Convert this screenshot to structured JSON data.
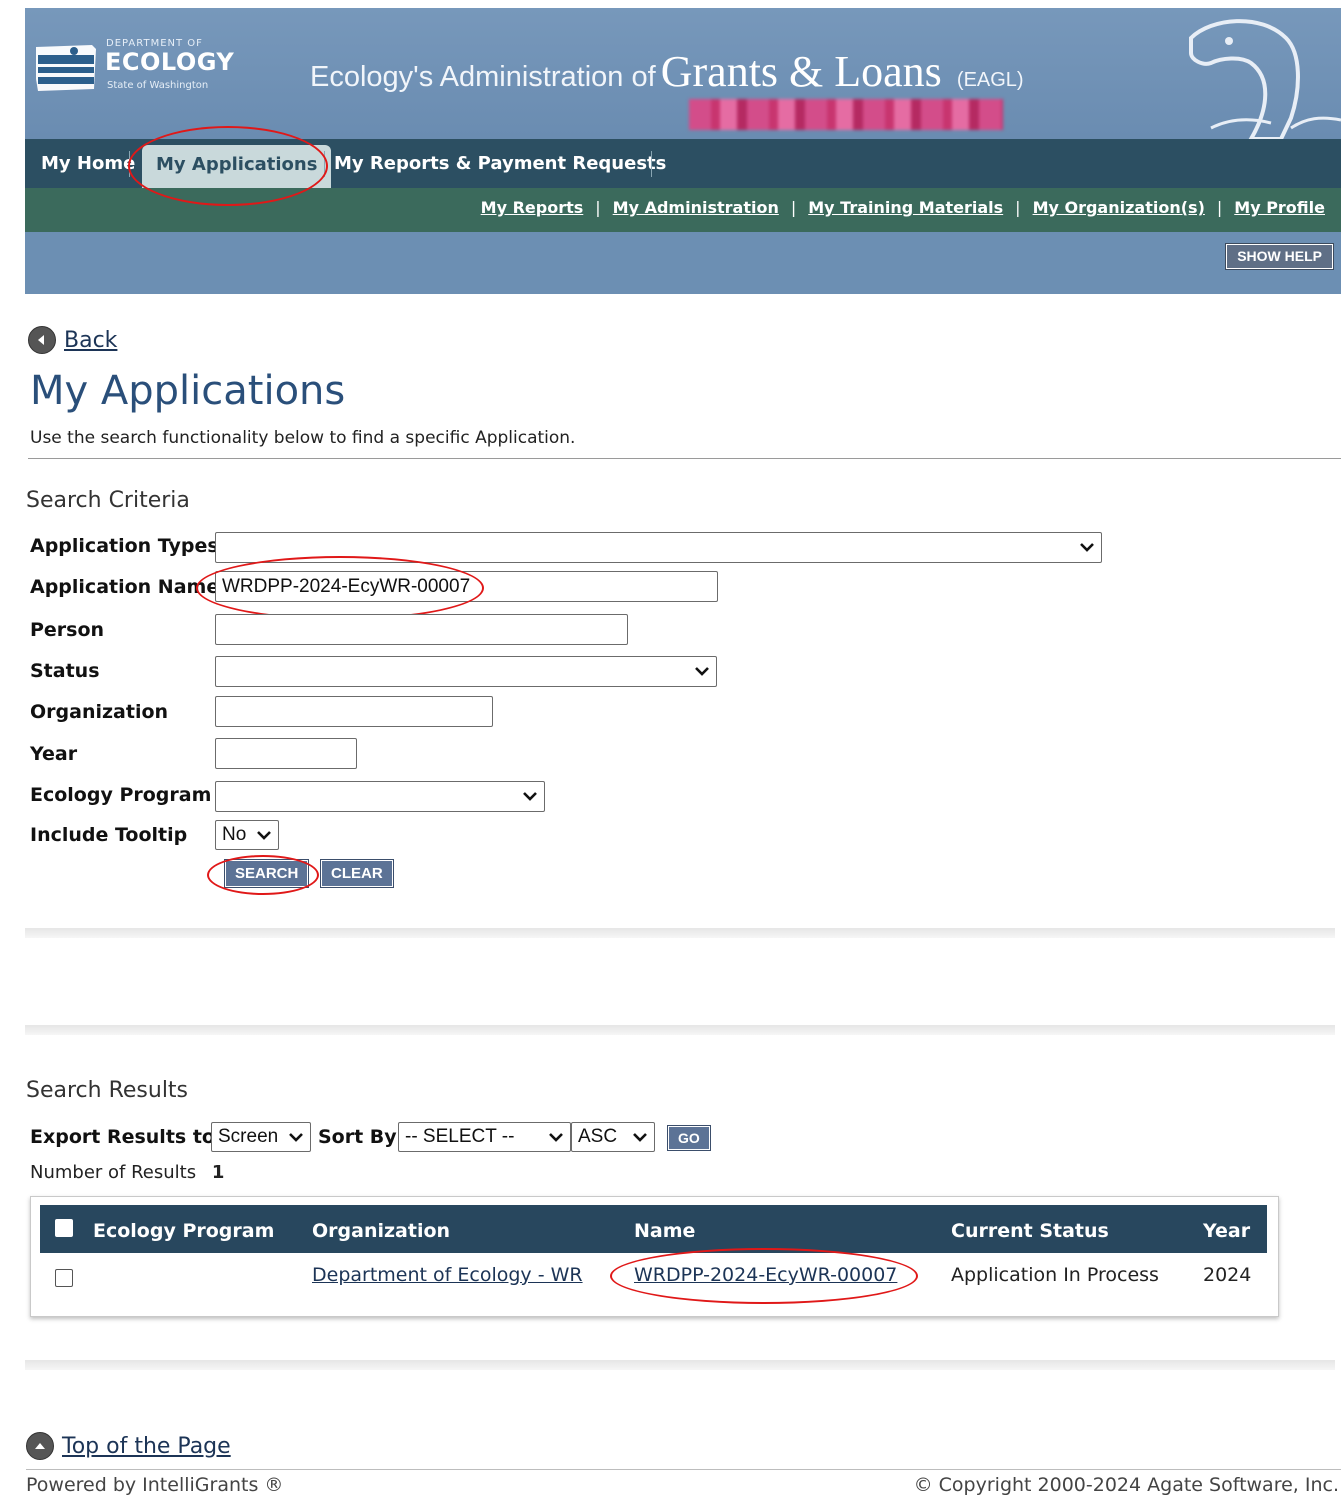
{
  "header": {
    "logo": {
      "dept": "DEPARTMENT OF",
      "name": "ECOLOGY",
      "state": "State of Washington"
    },
    "title_prefix": "Ecology's Administration of",
    "title_main": "Grants & Loans",
    "title_abbr": "(EAGL)"
  },
  "nav": {
    "tabs": [
      {
        "label": "My Home"
      },
      {
        "label": "My Applications"
      },
      {
        "label": "My Reports & Payment Requests"
      }
    ],
    "sublinks": [
      {
        "label": "My Reports"
      },
      {
        "label": "My Administration"
      },
      {
        "label": "My Training Materials"
      },
      {
        "label": "My Organization(s)"
      },
      {
        "label": "My Profile"
      }
    ],
    "help_button": "SHOW HELP"
  },
  "page": {
    "back": "Back",
    "title": "My Applications",
    "subtitle": "Use the search functionality below to find a specific Application."
  },
  "search": {
    "heading": "Search Criteria",
    "labels": {
      "application_types": "Application Types",
      "application_name": "Application Name",
      "person": "Person",
      "status": "Status",
      "organization": "Organization",
      "year": "Year",
      "ecology_program": "Ecology Program",
      "include_tooltip": "Include Tooltip"
    },
    "values": {
      "application_types": "",
      "application_name": "WRDPP-2024-EcyWR-00007",
      "person": "",
      "status": "",
      "organization": "",
      "year": "",
      "ecology_program": "",
      "include_tooltip": "No"
    },
    "search_button": "SEARCH",
    "clear_button": "CLEAR"
  },
  "results": {
    "heading": "Search Results",
    "export_label": "Export Results to",
    "export_value": "Screen",
    "sort_label": "Sort By",
    "sort_value": "-- SELECT --",
    "order_value": "ASC",
    "go_button": "GO",
    "count_label": "Number of Results",
    "count": "1",
    "columns": [
      "Ecology Program",
      "Organization",
      "Name",
      "Current Status",
      "Year"
    ],
    "rows": [
      {
        "ecology_program": "",
        "organization": "Department of Ecology - WR",
        "name": "WRDPP-2024-EcyWR-00007",
        "status": "Application In Process",
        "year": "2024"
      }
    ]
  },
  "footer": {
    "top_link": "Top of the Page",
    "powered": "Powered by IntelliGrants ®",
    "copyright": "© Copyright 2000-2024 Agate Software, Inc."
  },
  "colors": {
    "annotation": "#e01818",
    "nav_bg": "#2c4f62",
    "subnav_bg": "#3b6a5c",
    "banner_bg": "#6f8fb2",
    "table_header": "#28475e"
  }
}
